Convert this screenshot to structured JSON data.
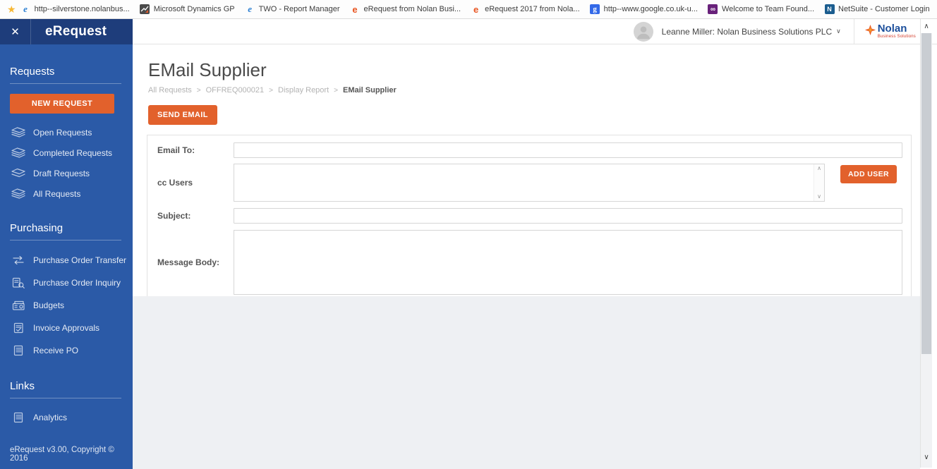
{
  "browser": {
    "bookmarks": [
      {
        "label": "http--silverstone.nolanbus...",
        "icon": "ie-icon"
      },
      {
        "label": "Microsoft Dynamics GP",
        "icon": "dynamics-gp-icon"
      },
      {
        "label": "TWO - Report Manager",
        "icon": "ie-icon"
      },
      {
        "label": "eRequest from Nolan Busi...",
        "icon": "erequest-icon"
      },
      {
        "label": "eRequest 2017 from Nola...",
        "icon": "erequest-icon"
      },
      {
        "label": "http--www.google.co.uk-u...",
        "icon": "google-icon"
      },
      {
        "label": "Welcome to Team Found...",
        "icon": "team-foundation-icon"
      },
      {
        "label": "NetSuite - Customer Login",
        "icon": "netsuite-icon"
      }
    ]
  },
  "header": {
    "app_name": "eRequest",
    "user": "Leanne Miller: Nolan Business Solutions PLC",
    "brand_name": "Nolan",
    "brand_tagline": "Business Solutions"
  },
  "sidebar": {
    "new_request_label": "NEW REQUEST",
    "sections": [
      {
        "title": "Requests",
        "items": [
          {
            "label": "Open Requests",
            "icon": "requests-stack-icon"
          },
          {
            "label": "Completed Requests",
            "icon": "requests-stack-icon"
          },
          {
            "label": "Draft Requests",
            "icon": "requests-stack-icon"
          },
          {
            "label": "All Requests",
            "icon": "requests-stack-icon"
          }
        ]
      },
      {
        "title": "Purchasing",
        "items": [
          {
            "label": "Purchase Order Transfer",
            "icon": "transfer-arrows-icon"
          },
          {
            "label": "Purchase Order Inquiry",
            "icon": "document-search-icon"
          },
          {
            "label": "Budgets",
            "icon": "budgets-icon"
          },
          {
            "label": "Invoice Approvals",
            "icon": "invoice-check-icon"
          },
          {
            "label": "Receive PO",
            "icon": "document-icon"
          }
        ]
      },
      {
        "title": "Links",
        "items": [
          {
            "label": "Analytics",
            "icon": "document-icon"
          }
        ]
      }
    ],
    "footer": "eRequest v3.00, Copyright © 2016"
  },
  "main": {
    "title": "EMail Supplier",
    "breadcrumb": [
      "All Requests",
      "OFFREQ000021",
      "Display Report",
      "EMail Supplier"
    ],
    "send_email_label": "SEND EMAIL",
    "form": {
      "email_to": {
        "label": "Email To:",
        "value": ""
      },
      "cc_users": {
        "label": "cc Users",
        "value": ""
      },
      "add_user_label": "ADD USER",
      "subject": {
        "label": "Subject:",
        "value": ""
      },
      "message_body": {
        "label": "Message Body:",
        "value": ""
      }
    }
  },
  "colors": {
    "header_blue": "#1e3d7b",
    "sidebar_blue": "#2b5aa7",
    "accent_orange": "#e2612c",
    "brand_blue": "#1b4e9b",
    "brand_red": "#d33927"
  }
}
